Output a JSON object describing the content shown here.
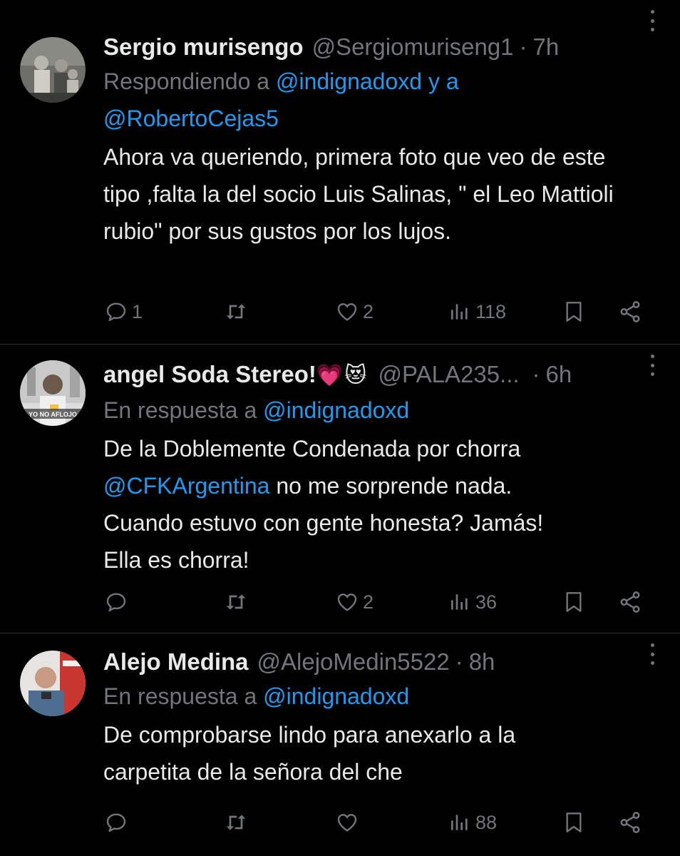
{
  "tweets": [
    {
      "name": "Sergio murisengo",
      "handle": "@Sergiomuriseng1",
      "separator": "·",
      "time": "7h",
      "reply_prefix": "Respondiendo a",
      "reply_to": "@indignadoxd y a",
      "reply_to_2": "@RobertoCejas5",
      "text": "Ahora va queriendo, primera foto que veo de este tipo ,falta la del socio Luis Salinas, \" el Leo Mattioli rubio\" por sus gustos por los lujos.",
      "replies": "1",
      "retweets": "",
      "likes": "2",
      "views": "118"
    },
    {
      "name": "angel Soda Stereo!",
      "emoji_1": "💗",
      "emoji_2": "😻",
      "handle": "@PALA235...",
      "separator": "·",
      "time": "6h",
      "reply_prefix": "En respuesta a",
      "reply_to": "@indignadoxd",
      "avatar_caption": "YO NO AFLOJO",
      "text_1": "De la Doblemente Condenada por chorra",
      "text_mention": "@CFKArgentina",
      "text_2": " no me sorprende nada.",
      "text_3": "Cuando estuvo con gente honesta? Jamás!",
      "text_4": "Ella es chorra!",
      "replies": "",
      "retweets": "",
      "likes": "2",
      "views": "36"
    },
    {
      "name": "Alejo Medina",
      "handle": "@AlejoMedin5522",
      "separator": "·",
      "time": "8h",
      "reply_prefix": "En respuesta a",
      "reply_to": "@indignadoxd",
      "text": "De comprobarse lindo para anexarlo a la carpetita de la señora del che",
      "replies": "",
      "retweets": "",
      "likes": "",
      "views": "88"
    }
  ],
  "icons": {
    "reply": "reply-icon",
    "retweet": "retweet-icon",
    "like": "like-icon",
    "views": "views-icon",
    "bookmark": "bookmark-icon",
    "share": "share-icon",
    "more": "more-icon"
  },
  "colors": {
    "background": "#000000",
    "text": "#e7e9ea",
    "muted": "#71767b",
    "link": "#1d9bf0",
    "divider": "#2f3336"
  }
}
